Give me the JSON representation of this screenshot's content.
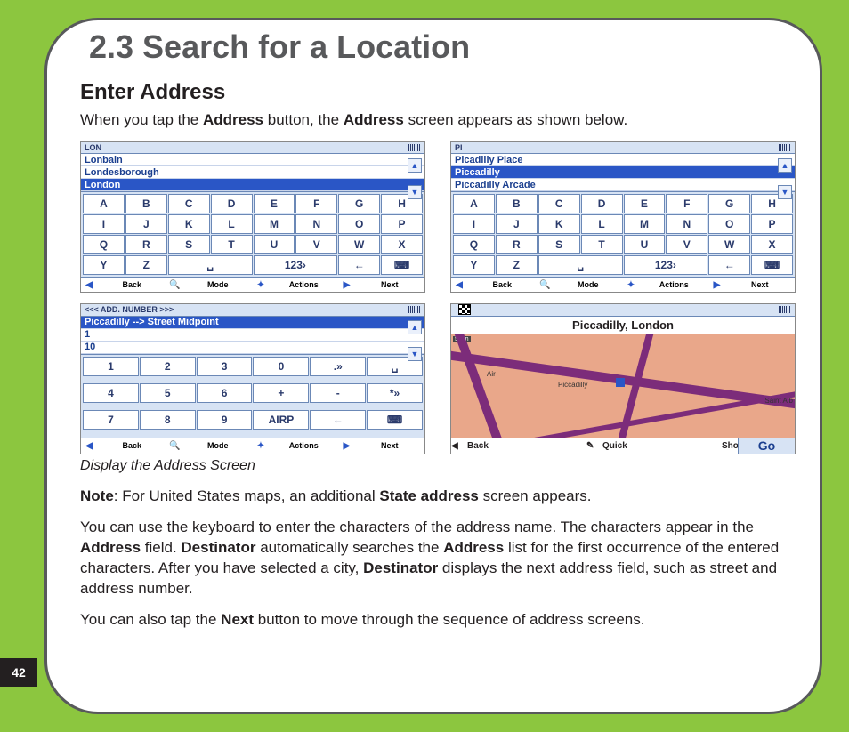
{
  "page_number": "42",
  "section_title": "2.3 Search for a Location",
  "subhead": "Enter Address",
  "intro_pre": "When you tap the ",
  "intro_b1": "Address",
  "intro_mid": " button, the ",
  "intro_b2": "Address",
  "intro_post": " screen appears as shown below.",
  "caption": "Display the Address Screen",
  "note_label": "Note",
  "note_mid": ": For United States maps, an additional ",
  "note_b": "State address",
  "note_post": " screen appears.",
  "para2_a": "You can use the keyboard to enter the characters of the address name. The characters appear in the ",
  "para2_b1": "Address",
  "para2_b": " field. ",
  "para2_b2": "Destinator",
  "para2_c": " automatically searches the ",
  "para2_b3": "Address",
  "para2_d": " list for the first occurrence of the entered characters. After you have selected a city, ",
  "para2_b4": "Destinator",
  "para2_e": " displays the next address field, such as street and address number.",
  "para3_a": "You can also tap the ",
  "para3_b": "Next",
  "para3_c": " button to move through the sequence of address screens.",
  "shot1": {
    "query": "LON",
    "items": [
      "Lonbain",
      "Londesborough",
      "London"
    ],
    "selected_index": 2,
    "alpha_keys": [
      "A",
      "B",
      "C",
      "D",
      "E",
      "F",
      "G",
      "H",
      "I",
      "J",
      "K",
      "L",
      "M",
      "N",
      "O",
      "P",
      "Q",
      "R",
      "S",
      "T",
      "U",
      "V",
      "W",
      "X",
      "Y",
      "Z",
      "␣",
      "123›",
      "←",
      "⌨"
    ],
    "bottom": {
      "back": "Back",
      "mode": "Mode",
      "actions": "Actions",
      "next": "Next"
    }
  },
  "shot2": {
    "query": "PI",
    "items": [
      "Picadilly Place",
      "Piccadilly",
      "Piccadilly Arcade"
    ],
    "selected_index": 1,
    "alpha_keys": [
      "A",
      "B",
      "C",
      "D",
      "E",
      "F",
      "G",
      "H",
      "I",
      "J",
      "K",
      "L",
      "M",
      "N",
      "O",
      "P",
      "Q",
      "R",
      "S",
      "T",
      "U",
      "V",
      "W",
      "X",
      "Y",
      "Z",
      "␣",
      "123›",
      "←",
      "⌨"
    ],
    "bottom": {
      "back": "Back",
      "mode": "Mode",
      "actions": "Actions",
      "next": "Next"
    }
  },
  "shot3": {
    "header": "<<<  ADD. NUMBER  >>>",
    "items": [
      "Piccadilly --> Street Midpoint",
      "1",
      "10"
    ],
    "selected_index": 0,
    "num_keys": [
      "1",
      "2",
      "3",
      "0",
      ".»",
      "␣",
      "4",
      "5",
      "6",
      "+",
      "-",
      "*»",
      "7",
      "8",
      "9",
      "AIRP",
      "←",
      "⌨"
    ],
    "bottom": {
      "back": "Back",
      "mode": "Mode",
      "actions": "Actions",
      "next": "Next"
    }
  },
  "shot4": {
    "title": "Piccadilly, London",
    "scale": "50 m",
    "labels": {
      "air": "Air",
      "picc": "Piccadilly",
      "sa": "Saint Alb"
    },
    "bottom": {
      "back": "Back",
      "quick": "Quick",
      "short": "Short",
      "go": "Go"
    }
  }
}
